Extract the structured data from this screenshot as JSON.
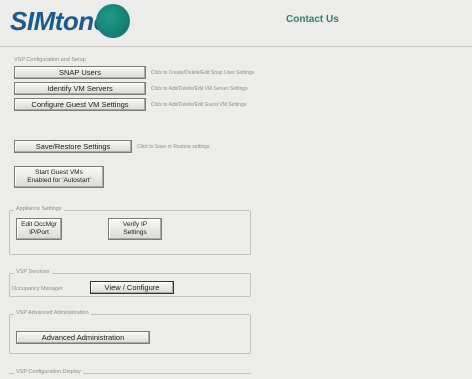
{
  "header": {
    "logo_text": "SIMtone",
    "logo_mark": "®",
    "contact_label": "Contact Us"
  },
  "vsp_setup": {
    "section_label": "VSP Configuration and Setup",
    "buttons": [
      {
        "label": "SNAP Users",
        "hint": "Click to Create/Delete/Edit Snap User Settings"
      },
      {
        "label": "Identify VM Servers",
        "hint": "Click to Add/Delete/Edit VM Server Settings"
      },
      {
        "label": "Configure Guest VM Settings",
        "hint": "Click to Add/Delete/Edit Guest VM Settings"
      }
    ]
  },
  "save_restore": {
    "label": "Save/Restore Settings",
    "hint": "Click to Save or Restore settings"
  },
  "start_guest": {
    "line1": "Start Guest VMs",
    "line2": "Enabled for 'Autostart'"
  },
  "appliance": {
    "section_label": "Appliance Settings",
    "edit_line1": "Edit OccMgr",
    "edit_line2": "IP/Port",
    "verify_line1": "Verify IP",
    "verify_line2": "Settings"
  },
  "services": {
    "section_label": "VSP Services",
    "occupancy_label": "Occupancy Manager",
    "view_configure_label": "View / Configure"
  },
  "advanced": {
    "section_label": "VSP Advanced Administration",
    "button_label": "Advanced Administration"
  },
  "config_display": {
    "section_label": "VSP Configuration Display"
  },
  "colors": {
    "logo_text": "#1a5a8c",
    "logo_circle": "#1f9a8a",
    "contact": "#3a7a6a",
    "background": "#ececea"
  }
}
